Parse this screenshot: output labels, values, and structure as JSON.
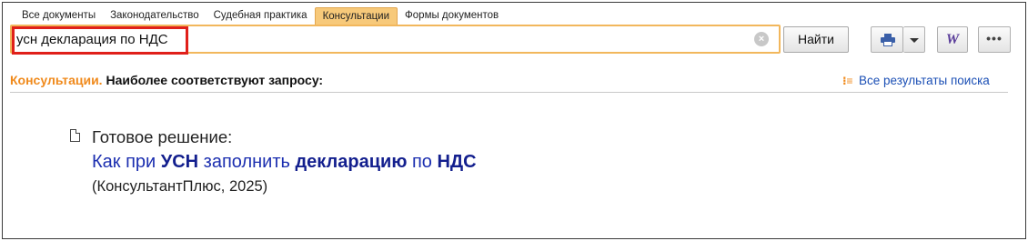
{
  "tabs": [
    {
      "label": "Все документы",
      "active": false
    },
    {
      "label": "Законодательство",
      "active": false
    },
    {
      "label": "Судебная практика",
      "active": false
    },
    {
      "label": "Консультации",
      "active": true
    },
    {
      "label": "Формы документов",
      "active": false
    }
  ],
  "search": {
    "value": "усн декларация по НДС",
    "button_label": "Найти"
  },
  "toolbar": {
    "print_icon": "printer-icon",
    "dropdown_icon": "chevron-down-icon",
    "word_icon_text": "W",
    "more_icon_text": "•••"
  },
  "results_header": {
    "section": "Консультации.",
    "label": "Наиболее соответствуют запросу:",
    "all_results_link": "Все результаты поиска"
  },
  "result": {
    "kind": "Готовое решение:",
    "title_parts": [
      {
        "text": "Как при ",
        "bold": false
      },
      {
        "text": "УСН",
        "bold": true
      },
      {
        "text": " заполнить ",
        "bold": false
      },
      {
        "text": "декларацию",
        "bold": true
      },
      {
        "text": " по ",
        "bold": false
      },
      {
        "text": "НДС",
        "bold": true
      }
    ],
    "source": "(КонсультантПлюс, 2025)"
  },
  "colors": {
    "active_tab": "#f7c97a",
    "search_border": "#f2b75c",
    "highlight_box": "#e0201a",
    "section_orange": "#f08a1c",
    "link_blue": "#1c2fb0"
  }
}
